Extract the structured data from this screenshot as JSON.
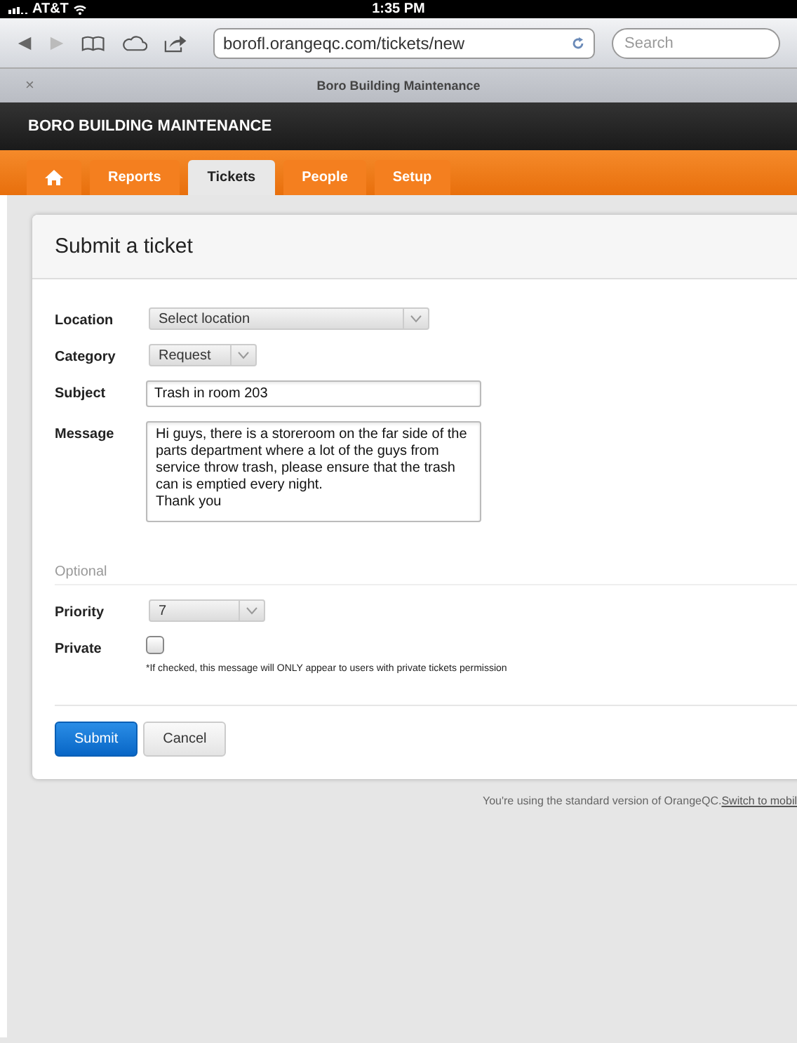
{
  "status_bar": {
    "carrier": "AT&T",
    "time": "1:35 PM"
  },
  "browser": {
    "url": "borofl.orangeqc.com/tickets/new",
    "search_placeholder": "Search",
    "tab_close": "×",
    "tab_title": "Boro Building Maintenance"
  },
  "site_title": "BORO BUILDING MAINTENANCE",
  "nav": [
    {
      "kind": "home",
      "selected": false
    },
    {
      "kind": "text",
      "label": "Reports",
      "selected": false
    },
    {
      "kind": "text",
      "label": "Tickets",
      "selected": true
    },
    {
      "kind": "text",
      "label": "People",
      "selected": false
    },
    {
      "kind": "text",
      "label": "Setup",
      "selected": false
    }
  ],
  "card_title": "Submit a ticket",
  "fields": [
    {
      "kind": "select",
      "label": "Location",
      "value": "Select location"
    },
    {
      "kind": "select",
      "label": "Category",
      "value": "Request"
    },
    {
      "kind": "text",
      "label": "Subject",
      "value": "Trash in room 203"
    },
    {
      "kind": "textarea",
      "label": "Message",
      "value": "Hi guys, there is a storeroom on the far side of the parts department where a lot of the guys from service throw trash, please ensure that the trash can is emptied every night.\nThank you"
    }
  ],
  "optional_heading": "Optional",
  "optional_fields": [
    {
      "kind": "select",
      "label": "Priority",
      "value": "7"
    },
    {
      "kind": "checkbox",
      "label": "Private",
      "checked": false,
      "note": "*If checked, this message will ONLY appear to users with private tickets permission"
    }
  ],
  "buttons": [
    {
      "kind": "primary",
      "label": "Submit"
    },
    {
      "kind": "secondary",
      "label": "Cancel"
    }
  ],
  "footer": {
    "text": "You're using the standard version of OrangeQC.",
    "link": "Switch to mobil"
  }
}
